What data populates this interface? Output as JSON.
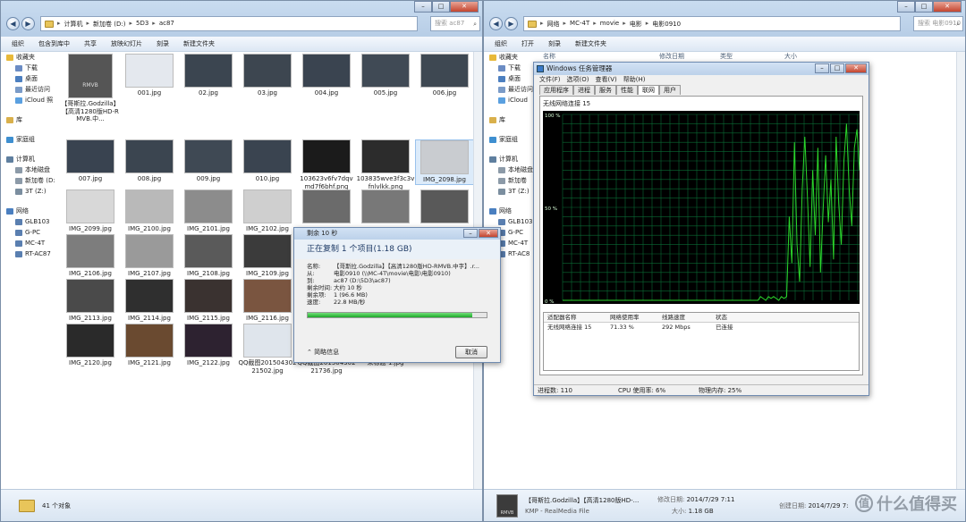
{
  "left_window": {
    "address": [
      "计算机",
      "新加卷 (D:)",
      "5D3",
      "ac87"
    ],
    "search_placeholder": "搜索 ac87",
    "toolbar": [
      "组织",
      "包含到库中",
      "共享",
      "放映幻灯片",
      "刻录",
      "新建文件夹"
    ],
    "sidebar": [
      {
        "label": "收藏夹",
        "top": true,
        "icon": "star-icon",
        "color": "#e8b93a"
      },
      {
        "label": "下载",
        "top": false,
        "icon": "download-folder-icon",
        "color": "#6b8cc4"
      },
      {
        "label": "桌面",
        "top": false,
        "icon": "desktop-icon",
        "color": "#4c7fc0"
      },
      {
        "label": "最近访问",
        "top": false,
        "icon": "recent-icon",
        "color": "#7a9bc8"
      },
      {
        "label": "iCloud 照",
        "top": false,
        "icon": "icloud-icon",
        "color": "#5aa0e0"
      },
      {
        "gap": true
      },
      {
        "label": "库",
        "top": true,
        "icon": "library-icon",
        "color": "#d9b04b"
      },
      {
        "gap": true
      },
      {
        "label": "家庭组",
        "top": true,
        "icon": "homegroup-icon",
        "color": "#3e8fd0"
      },
      {
        "gap": true
      },
      {
        "label": "计算机",
        "top": true,
        "icon": "computer-icon",
        "color": "#5f7f9f"
      },
      {
        "label": "本地磁盘",
        "top": false,
        "icon": "drive-icon",
        "color": "#8c9aa8"
      },
      {
        "label": "新加卷 (D:",
        "top": false,
        "icon": "drive-icon",
        "color": "#8c9aa8"
      },
      {
        "label": "3T (Z:)",
        "top": false,
        "icon": "network-drive-icon",
        "color": "#7b8e9f"
      },
      {
        "gap": true
      },
      {
        "label": "网络",
        "top": true,
        "icon": "network-icon",
        "color": "#4a7fc0"
      },
      {
        "label": "GLB103",
        "top": false,
        "icon": "pc-icon",
        "color": "#5a7fb0"
      },
      {
        "label": "G-PC",
        "top": false,
        "icon": "pc-icon",
        "color": "#5a7fb0"
      },
      {
        "label": "MC-4T",
        "top": false,
        "icon": "pc-icon",
        "color": "#5a7fb0"
      },
      {
        "label": "RT-AC87",
        "top": false,
        "icon": "pc-icon",
        "color": "#5a7fb0"
      }
    ],
    "files": [
      {
        "name": "【哥斯拉.Godzilla】【高清1280版HD-RMVB.中...",
        "color": "#555"
      },
      {
        "name": "001.jpg",
        "color": "#e4e8ee"
      },
      {
        "name": "02.jpg",
        "color": "#3b4550"
      },
      {
        "name": "03.jpg",
        "color": "#3d4650"
      },
      {
        "name": "004.jpg",
        "color": "#3a4450"
      },
      {
        "name": "005.jpg",
        "color": "#404a55"
      },
      {
        "name": "006.jpg",
        "color": "#3e4852"
      },
      {
        "name": "007.jpg",
        "color": "#394350"
      },
      {
        "name": "008.jpg",
        "color": "#3b4550"
      },
      {
        "name": "009.jpg",
        "color": "#3f4954"
      },
      {
        "name": "010.jpg",
        "color": "#3a4450"
      },
      {
        "name": "103623v6fv7dqvmd7f6bhf.png",
        "color": "#1b1b1b"
      },
      {
        "name": "103835wve3f3c3vfnlvlkk.png",
        "color": "#2c2c2c"
      },
      {
        "name": "IMG_2098.jpg",
        "color": "#c9ccd0"
      },
      {
        "name": "IMG_2099.jpg",
        "color": "#d8d8d8"
      },
      {
        "name": "IMG_2100.jpg",
        "color": "#b9b9b9"
      },
      {
        "name": "IMG_2101.jpg",
        "color": "#8c8c8c"
      },
      {
        "name": "IMG_2102.jpg",
        "color": "#cfcfcf"
      },
      {
        "name": "",
        "color": "#6b6b6b"
      },
      {
        "name": "",
        "color": "#787878"
      },
      {
        "name": "",
        "color": "#595959"
      },
      {
        "name": "IMG_2106.jpg",
        "color": "#7d7d7d"
      },
      {
        "name": "IMG_2107.jpg",
        "color": "#9a9a9a"
      },
      {
        "name": "IMG_2108.jpg",
        "color": "#5a5a5a"
      },
      {
        "name": "IMG_2109.jpg",
        "color": "#3b3b3b"
      },
      {
        "name": "",
        "color": "#4d4d4d"
      },
      {
        "name": "",
        "color": "#5c5c5c"
      },
      {
        "name": "",
        "color": "#6e6e6e"
      },
      {
        "name": "IMG_2113.jpg",
        "color": "#4a4a4a"
      },
      {
        "name": "IMG_2114.jpg",
        "color": "#2f2f2f"
      },
      {
        "name": "IMG_2115.jpg",
        "color": "#3a3230"
      },
      {
        "name": "IMG_2116.jpg",
        "color": "#7a5540"
      },
      {
        "name": "",
        "color": "#555"
      },
      {
        "name": "",
        "color": "#444"
      },
      {
        "name": "",
        "color": "#5a5a5a"
      },
      {
        "name": "IMG_2120.jpg",
        "color": "#2a2a2a"
      },
      {
        "name": "IMG_2121.jpg",
        "color": "#6a4a30"
      },
      {
        "name": "IMG_2122.jpg",
        "color": "#2d2230"
      },
      {
        "name": "QQ截图20150430221502.jpg",
        "color": "#dfe5ec"
      },
      {
        "name": "QQ截图20150430221736.jpg",
        "color": "#e2e7ee"
      },
      {
        "name": "未标题-1.jpg",
        "color": "#3c3c3c"
      }
    ],
    "status": "41 个对象"
  },
  "right_window": {
    "address": [
      "网络",
      "MC-4T",
      "movie",
      "电影",
      "电影0910"
    ],
    "search_placeholder": "搜索 电影0910",
    "toolbar": [
      "组织",
      "打开",
      "刻录",
      "新建文件夹"
    ],
    "columns": [
      "名称",
      "修改日期",
      "类型",
      "大小"
    ],
    "sidebar": [
      {
        "label": "收藏夹",
        "top": true,
        "icon": "star-icon",
        "color": "#e8b93a"
      },
      {
        "label": "下载",
        "top": false,
        "icon": "download-folder-icon",
        "color": "#6b8cc4"
      },
      {
        "label": "桌面",
        "top": false,
        "icon": "desktop-icon",
        "color": "#4c7fc0"
      },
      {
        "label": "最近访问",
        "top": false,
        "icon": "recent-icon",
        "color": "#7a9bc8"
      },
      {
        "label": "iCloud",
        "top": false,
        "icon": "icloud-icon",
        "color": "#5aa0e0"
      },
      {
        "gap": true
      },
      {
        "label": "库",
        "top": true,
        "icon": "library-icon",
        "color": "#d9b04b"
      },
      {
        "gap": true
      },
      {
        "label": "家庭组",
        "top": true,
        "icon": "homegroup-icon",
        "color": "#3e8fd0"
      },
      {
        "gap": true
      },
      {
        "label": "计算机",
        "top": true,
        "icon": "computer-icon",
        "color": "#5f7f9f"
      },
      {
        "label": "本地磁盘",
        "top": false,
        "icon": "drive-icon",
        "color": "#8c9aa8"
      },
      {
        "label": "新加卷",
        "top": false,
        "icon": "drive-icon",
        "color": "#8c9aa8"
      },
      {
        "label": "3T (Z:)",
        "top": false,
        "icon": "network-drive-icon",
        "color": "#7b8e9f"
      },
      {
        "gap": true
      },
      {
        "label": "网络",
        "top": true,
        "icon": "network-icon",
        "color": "#4a7fc0"
      },
      {
        "label": "GLB103",
        "top": false,
        "icon": "pc-icon",
        "color": "#5a7fb0"
      },
      {
        "label": "G-PC",
        "top": false,
        "icon": "pc-icon",
        "color": "#5a7fb0"
      },
      {
        "label": "MC-4T",
        "top": false,
        "icon": "pc-icon",
        "color": "#5a7fb0"
      },
      {
        "label": "RT-AC8",
        "top": false,
        "icon": "pc-icon",
        "color": "#5a7fb0"
      }
    ],
    "status": {
      "name": "【哥斯拉.Godzilla】【高清1280版HD-...",
      "type": "KMP - RealMedia File",
      "modified_label": "修改日期:",
      "modified": "2014/7/29 7:11",
      "created_label": "创建日期:",
      "created": "2014/7/29 7:",
      "size_label": "大小:",
      "size": "1.18 GB"
    }
  },
  "copy_dialog": {
    "title": "剩余 10 秒",
    "heading": "正在复制 1 个项目(1.18 GB)",
    "rows": [
      {
        "k": "名称:",
        "v": "【哥斯拉.Godzilla】【高清1280版HD-RMVB.中字】.r..."
      },
      {
        "k": "从:",
        "v": "电影0910 (\\\\MC-4T\\movie\\电影\\电影0910)"
      },
      {
        "k": "到:",
        "v": "ac87 (D:\\5D3\\ac87)"
      },
      {
        "k": "剩余时间:",
        "v": "大约 10 秒"
      },
      {
        "k": "剩余项:",
        "v": "1 (96.6 MB)"
      },
      {
        "k": "速度:",
        "v": "22.8 MB/秒"
      }
    ],
    "progress": 0.92,
    "details_label": "简略信息",
    "cancel_label": "取消"
  },
  "task_manager": {
    "title": "Windows 任务管理器",
    "menu": [
      "文件(F)",
      "选项(O)",
      "查看(V)",
      "帮助(H)"
    ],
    "tabs": [
      "应用程序",
      "进程",
      "服务",
      "性能",
      "联网",
      "用户"
    ],
    "active_tab": 4,
    "graph_label": "无线网络连接 15",
    "y_ticks": [
      "100 %",
      "50 %",
      "0 %"
    ],
    "adapter_headers": [
      "适配器名称",
      "网络使用率",
      "线路速度",
      "状态"
    ],
    "adapter_row": [
      "无线网络连接 15",
      "71.33 %",
      "292 Mbps",
      "已连接"
    ],
    "status": [
      "进程数: 110",
      "CPU 使用率: 6%",
      "物理内存: 25%"
    ]
  },
  "watermark": "什么值得买",
  "chart_data": {
    "type": "line",
    "title": "无线网络连接 15",
    "ylim": [
      0,
      100
    ],
    "series": [
      {
        "values": [
          0,
          0,
          0,
          0,
          0,
          0,
          0,
          0,
          0,
          0,
          0,
          0,
          0,
          0,
          0,
          0,
          0,
          0,
          0,
          0,
          0,
          0,
          0,
          0,
          0,
          0,
          0,
          0,
          0,
          0,
          0,
          0,
          0,
          0,
          0,
          0,
          0,
          0,
          0,
          0,
          0,
          0,
          0,
          0,
          0,
          0,
          0,
          0,
          0,
          0,
          0,
          0,
          0,
          0,
          0,
          0,
          0,
          0,
          0,
          0,
          0,
          0,
          0,
          0,
          0,
          0,
          0,
          0,
          0,
          0,
          0,
          0,
          0,
          0,
          0,
          0,
          2,
          1,
          0,
          2,
          1,
          2,
          1,
          0,
          2,
          1,
          2,
          45,
          20,
          85,
          30,
          10,
          60,
          88,
          55,
          18,
          70,
          35,
          82,
          15,
          48,
          78,
          42,
          65,
          22,
          88,
          52,
          30,
          75,
          95,
          60,
          40,
          82,
          92,
          70
        ]
      }
    ]
  }
}
